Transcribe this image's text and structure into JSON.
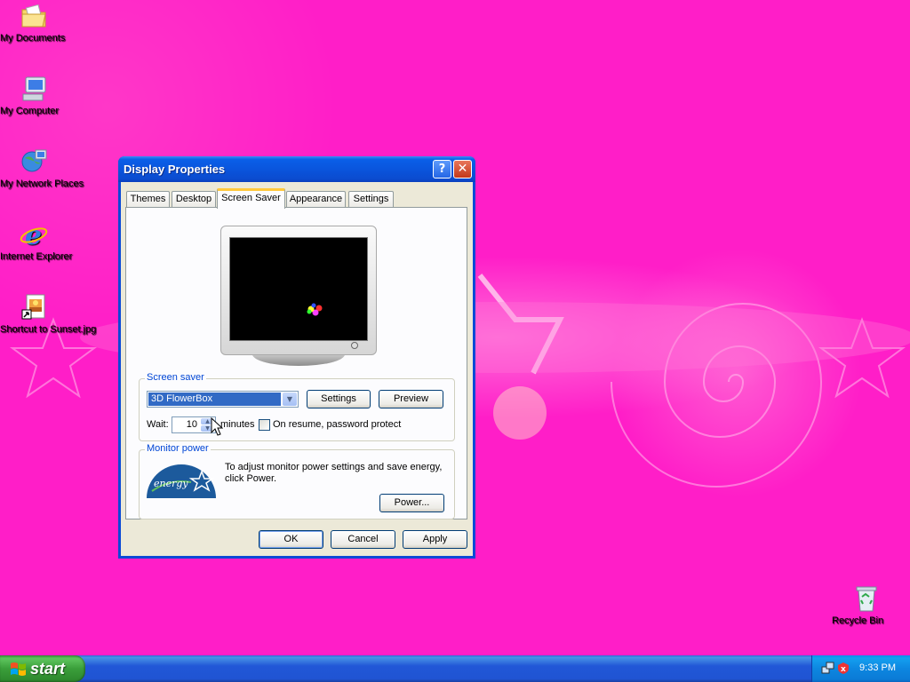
{
  "desktop": {
    "icons": [
      {
        "label": "My Documents"
      },
      {
        "label": "My Computer"
      },
      {
        "label": "My Network Places"
      },
      {
        "label": "Internet Explorer"
      },
      {
        "label": "Shortcut to Sunset.jpg"
      },
      {
        "label": "Recycle Bin"
      }
    ]
  },
  "window": {
    "title": "Display Properties",
    "help_icon": "help-icon",
    "close_icon": "close-icon",
    "tabs": [
      {
        "label": "Themes"
      },
      {
        "label": "Desktop"
      },
      {
        "label": "Screen Saver",
        "active": true
      },
      {
        "label": "Appearance"
      },
      {
        "label": "Settings"
      }
    ],
    "screen_saver_group": {
      "legend": "Screen saver",
      "selected": "3D FlowerBox",
      "settings_button": "Settings",
      "preview_button": "Preview",
      "wait_label": "Wait:",
      "wait_value": "10",
      "minutes_label": "minutes",
      "password_checkbox_label": "On resume, password protect",
      "password_checked": false
    },
    "monitor_power_group": {
      "legend": "Monitor power",
      "description": "To adjust monitor power settings and save energy, click Power.",
      "power_button": "Power...",
      "logo": "energy-star-logo"
    },
    "buttons": {
      "ok": "OK",
      "cancel": "Cancel",
      "apply": "Apply"
    }
  },
  "taskbar": {
    "start_label": "start",
    "clock": "9:33 PM"
  },
  "colors": {
    "desktop_background": "#ff1ec8",
    "titlebar": "#0a55dd",
    "taskbar": "#2157d7",
    "start_button": "#3a9e3a",
    "selection": "#316ac5"
  }
}
